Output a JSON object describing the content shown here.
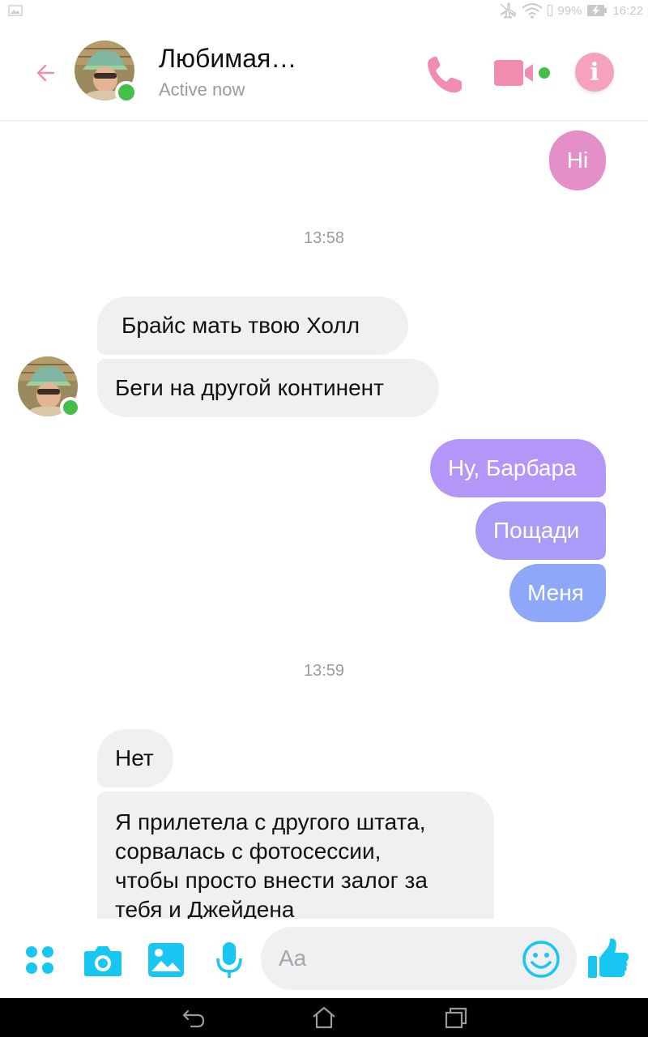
{
  "status_bar": {
    "battery_text": "99%",
    "time": "16:22",
    "icons": [
      "image-notification-icon",
      "airplane-mode-off-icon",
      "wifi-icon",
      "battery-charging-icon"
    ]
  },
  "header": {
    "contact_name": "Любимая…",
    "contact_status": "Active now",
    "accent_color": "#f08db0",
    "icons": [
      "back-arrow-icon",
      "phone-icon",
      "video-camera-icon",
      "info-icon"
    ]
  },
  "messages": [
    {
      "direction": "outgoing",
      "text": "Hi",
      "color": "#e58fc8"
    },
    {
      "type": "timestamp",
      "text": "13:58"
    },
    {
      "direction": "incoming",
      "text": "Брайс мать твою Холл"
    },
    {
      "direction": "incoming",
      "text": "Беги на другой континент"
    },
    {
      "direction": "outgoing",
      "text": "Ну, Барбара",
      "color": "#b496f8"
    },
    {
      "direction": "outgoing",
      "text": "Пощади",
      "color": "#a99bf8"
    },
    {
      "direction": "outgoing",
      "text": "Меня",
      "color": "#8ea7f8"
    },
    {
      "type": "timestamp",
      "text": "13:59"
    },
    {
      "direction": "incoming",
      "text": "Нет"
    },
    {
      "direction": "incoming",
      "lines": [
        "Я прилетела с другого штата,",
        "сорвалась с фотосессии,",
        "чтобы просто внести залог за",
        "тебя и Джейдена"
      ]
    }
  ],
  "composer": {
    "placeholder": "Aa",
    "accent_color": "#18c6f2",
    "icons": [
      "apps-grid-icon",
      "camera-icon",
      "gallery-icon",
      "microphone-icon",
      "emoji-icon",
      "thumbs-up-icon"
    ]
  },
  "nav_bar": {
    "icons": [
      "back-icon",
      "home-icon",
      "recent-apps-icon"
    ]
  }
}
